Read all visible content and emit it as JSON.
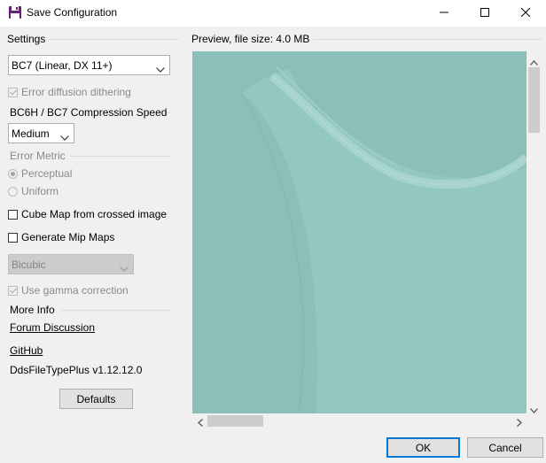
{
  "window": {
    "title": "Save Configuration"
  },
  "settings": {
    "group_label": "Settings",
    "format_value": "BC7 (Linear, DX 11+)",
    "error_diffusion_label": "Error diffusion dithering",
    "error_diffusion_checked": true,
    "speed_label": "BC6H / BC7 Compression Speed",
    "speed_value": "Medium",
    "error_metric_label": "Error Metric",
    "perceptual_label": "Perceptual",
    "uniform_label": "Uniform",
    "perceptual_selected": true,
    "cube_map_label": "Cube Map from crossed image",
    "mip_maps_label": "Generate Mip Maps",
    "resample_value": "Bicubic",
    "gamma_label": "Use gamma correction",
    "gamma_checked": true
  },
  "more_info": {
    "label": "More Info",
    "forum_link": "Forum Discussion",
    "github_link": "GitHub",
    "version": "DdsFileTypePlus v1.12.12.0"
  },
  "buttons": {
    "defaults": "Defaults",
    "ok": "OK",
    "cancel": "Cancel"
  },
  "preview": {
    "label": "Preview, file size: 4.0 MB"
  },
  "colors": {
    "preview_teal": "#8ec2bd",
    "accent": "#0078d7",
    "title_icon": "#68217a"
  },
  "icons": {
    "app": "floppy-disk-icon",
    "minimize": "minimize-icon",
    "maximize": "maximize-icon",
    "close": "close-icon",
    "dropdown": "chevron-down-icon"
  }
}
